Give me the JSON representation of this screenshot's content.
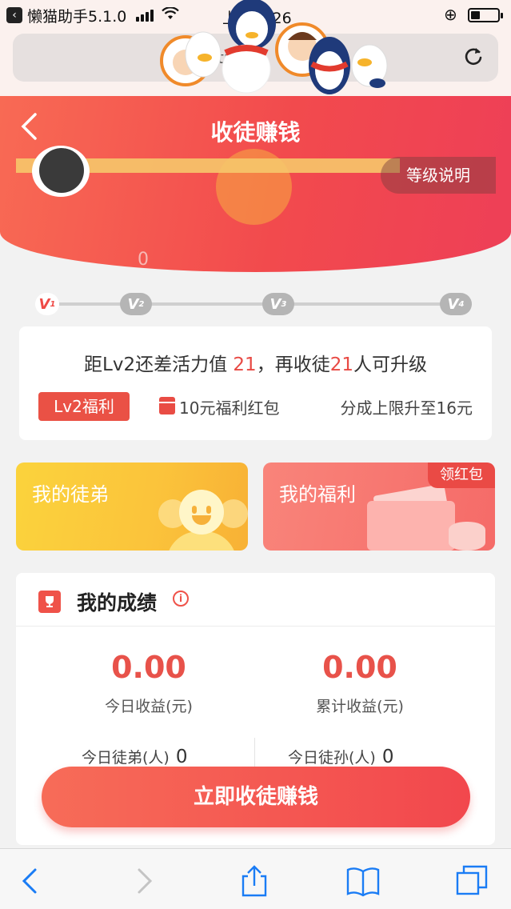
{
  "status_bar": {
    "back_app": "懒猫助手5.1.0",
    "time": "上午 9:26",
    "battery_level": 0.35
  },
  "browser": {
    "url_partial": "tr"
  },
  "header": {
    "title": "收徒赚钱",
    "level_desc_button": "等级说明",
    "faint_value": "0"
  },
  "levels": {
    "nodes": [
      {
        "label": "V",
        "sub": "1",
        "active": true
      },
      {
        "label": "V",
        "sub": "2",
        "active": false
      },
      {
        "label": "V",
        "sub": "3",
        "active": false
      },
      {
        "label": "V",
        "sub": "4",
        "active": false
      }
    ]
  },
  "level_card": {
    "text_prefix": "距Lv2还差活力值 ",
    "energy_needed": "21",
    "text_middle": "，再收徒",
    "disciples_needed": "21",
    "text_suffix": "人可升级",
    "perk_badge": "Lv2福利",
    "perk_redpack": "10元福利红包",
    "perk_share": "分成上限升至16元"
  },
  "cards": {
    "disciple_title": "我的徒弟",
    "welfare_title": "我的福利",
    "get_redpack": "领红包"
  },
  "achievements": {
    "title": "我的成绩",
    "today_income_value": "0.00",
    "today_income_label": "今日收益(元)",
    "total_income_value": "0.00",
    "total_income_label": "累计收益(元)",
    "today_disciples_label": "今日徒弟(人)",
    "today_disciples_value": "0",
    "today_grand_disciples_label": "今日徒孙(人)",
    "today_grand_disciples_value": "0"
  },
  "cta": {
    "label": "立即收徒赚钱"
  },
  "colors": {
    "accent": "#f24a4d",
    "gold": "#fbc33b",
    "text_highlight": "#e84a44"
  },
  "icons": {
    "back": "chevron-left-icon",
    "reload": "reload-icon",
    "trophy": "trophy-icon",
    "info": "info-icon",
    "redpack": "red-envelope-icon",
    "toolbar": [
      "back-arrow-icon",
      "forward-arrow-icon",
      "share-icon",
      "bookmarks-icon",
      "tabs-icon"
    ]
  }
}
